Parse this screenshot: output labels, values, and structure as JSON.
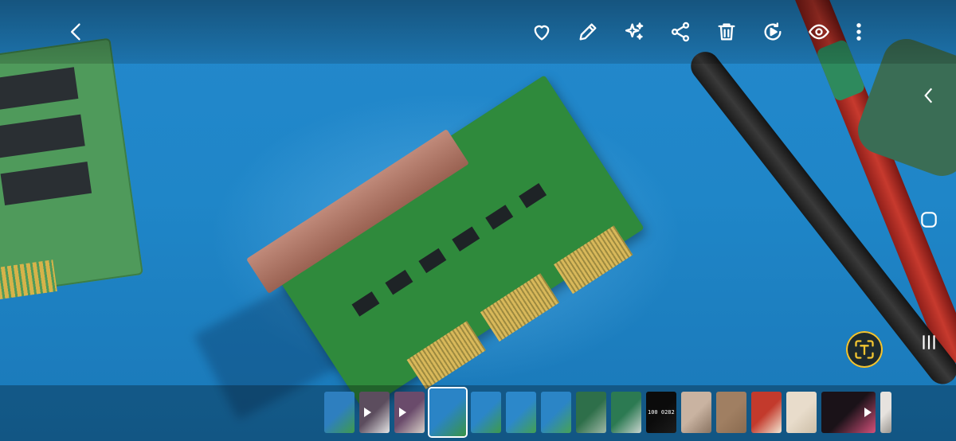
{
  "toolbar": {
    "back": {
      "icon": "back-arrow-icon"
    },
    "actions": [
      {
        "name": "favorite-button",
        "icon": "heart-icon"
      },
      {
        "name": "edit-button",
        "icon": "pencil-icon"
      },
      {
        "name": "ai-enhance-button",
        "icon": "sparkle-icon"
      },
      {
        "name": "share-button",
        "icon": "share-icon"
      },
      {
        "name": "delete-button",
        "icon": "trash-icon"
      },
      {
        "name": "remaster-button",
        "icon": "play-circle-icon"
      },
      {
        "name": "view-button",
        "icon": "eye-icon"
      },
      {
        "name": "more-options-button",
        "icon": "more-vertical-icon"
      }
    ]
  },
  "navigation": {
    "back": "chevron-left-icon",
    "home": "rounded-square-icon",
    "recents": "three-bars-icon"
  },
  "ocr_button": {
    "icon": "text-scan-icon",
    "accent": "#f2c531"
  },
  "filmstrip": {
    "thumbnails": [
      {
        "kind": "photo",
        "colors": [
          "#2e7fbf",
          "#3f9a4c"
        ],
        "video": false
      },
      {
        "kind": "video",
        "colors": [
          "#5c4d5e",
          "#e5e5e5"
        ],
        "video": true
      },
      {
        "kind": "video",
        "colors": [
          "#6a4b6b",
          "#d9d1c8"
        ],
        "video": true
      },
      {
        "kind": "photo",
        "colors": [
          "#2a84c6",
          "#3a9447"
        ],
        "video": false,
        "active": true
      },
      {
        "kind": "photo",
        "colors": [
          "#2b86c8",
          "#3e9a4b"
        ],
        "video": false
      },
      {
        "kind": "photo",
        "colors": [
          "#2c88ca",
          "#43a052"
        ],
        "video": false
      },
      {
        "kind": "photo",
        "colors": [
          "#2b85c6",
          "#47a256"
        ],
        "video": false
      },
      {
        "kind": "photo",
        "colors": [
          "#2e6f4a",
          "#9fb8a6"
        ],
        "video": false
      },
      {
        "kind": "photo",
        "colors": [
          "#2c7a52",
          "#c9d5cf"
        ],
        "video": false
      },
      {
        "kind": "photo",
        "colors": [
          "#0b0b0b",
          "#1c1c1c"
        ],
        "video": false,
        "label": "100 0282 080"
      },
      {
        "kind": "photo",
        "colors": [
          "#c9b3a1",
          "#8a7462"
        ],
        "video": false
      },
      {
        "kind": "photo",
        "colors": [
          "#a07f62",
          "#8a6b50"
        ],
        "video": false
      },
      {
        "kind": "photo",
        "colors": [
          "#c33a2c",
          "#f3e7d3"
        ],
        "video": false
      },
      {
        "kind": "photo",
        "colors": [
          "#e8dccb",
          "#cdbfa8"
        ],
        "video": false
      },
      {
        "kind": "video",
        "colors": [
          "#1a1218",
          "#d2507a"
        ],
        "video": true
      },
      {
        "kind": "photo",
        "colors": [
          "#e6e2de",
          "#9a9690"
        ],
        "video": false
      }
    ]
  }
}
